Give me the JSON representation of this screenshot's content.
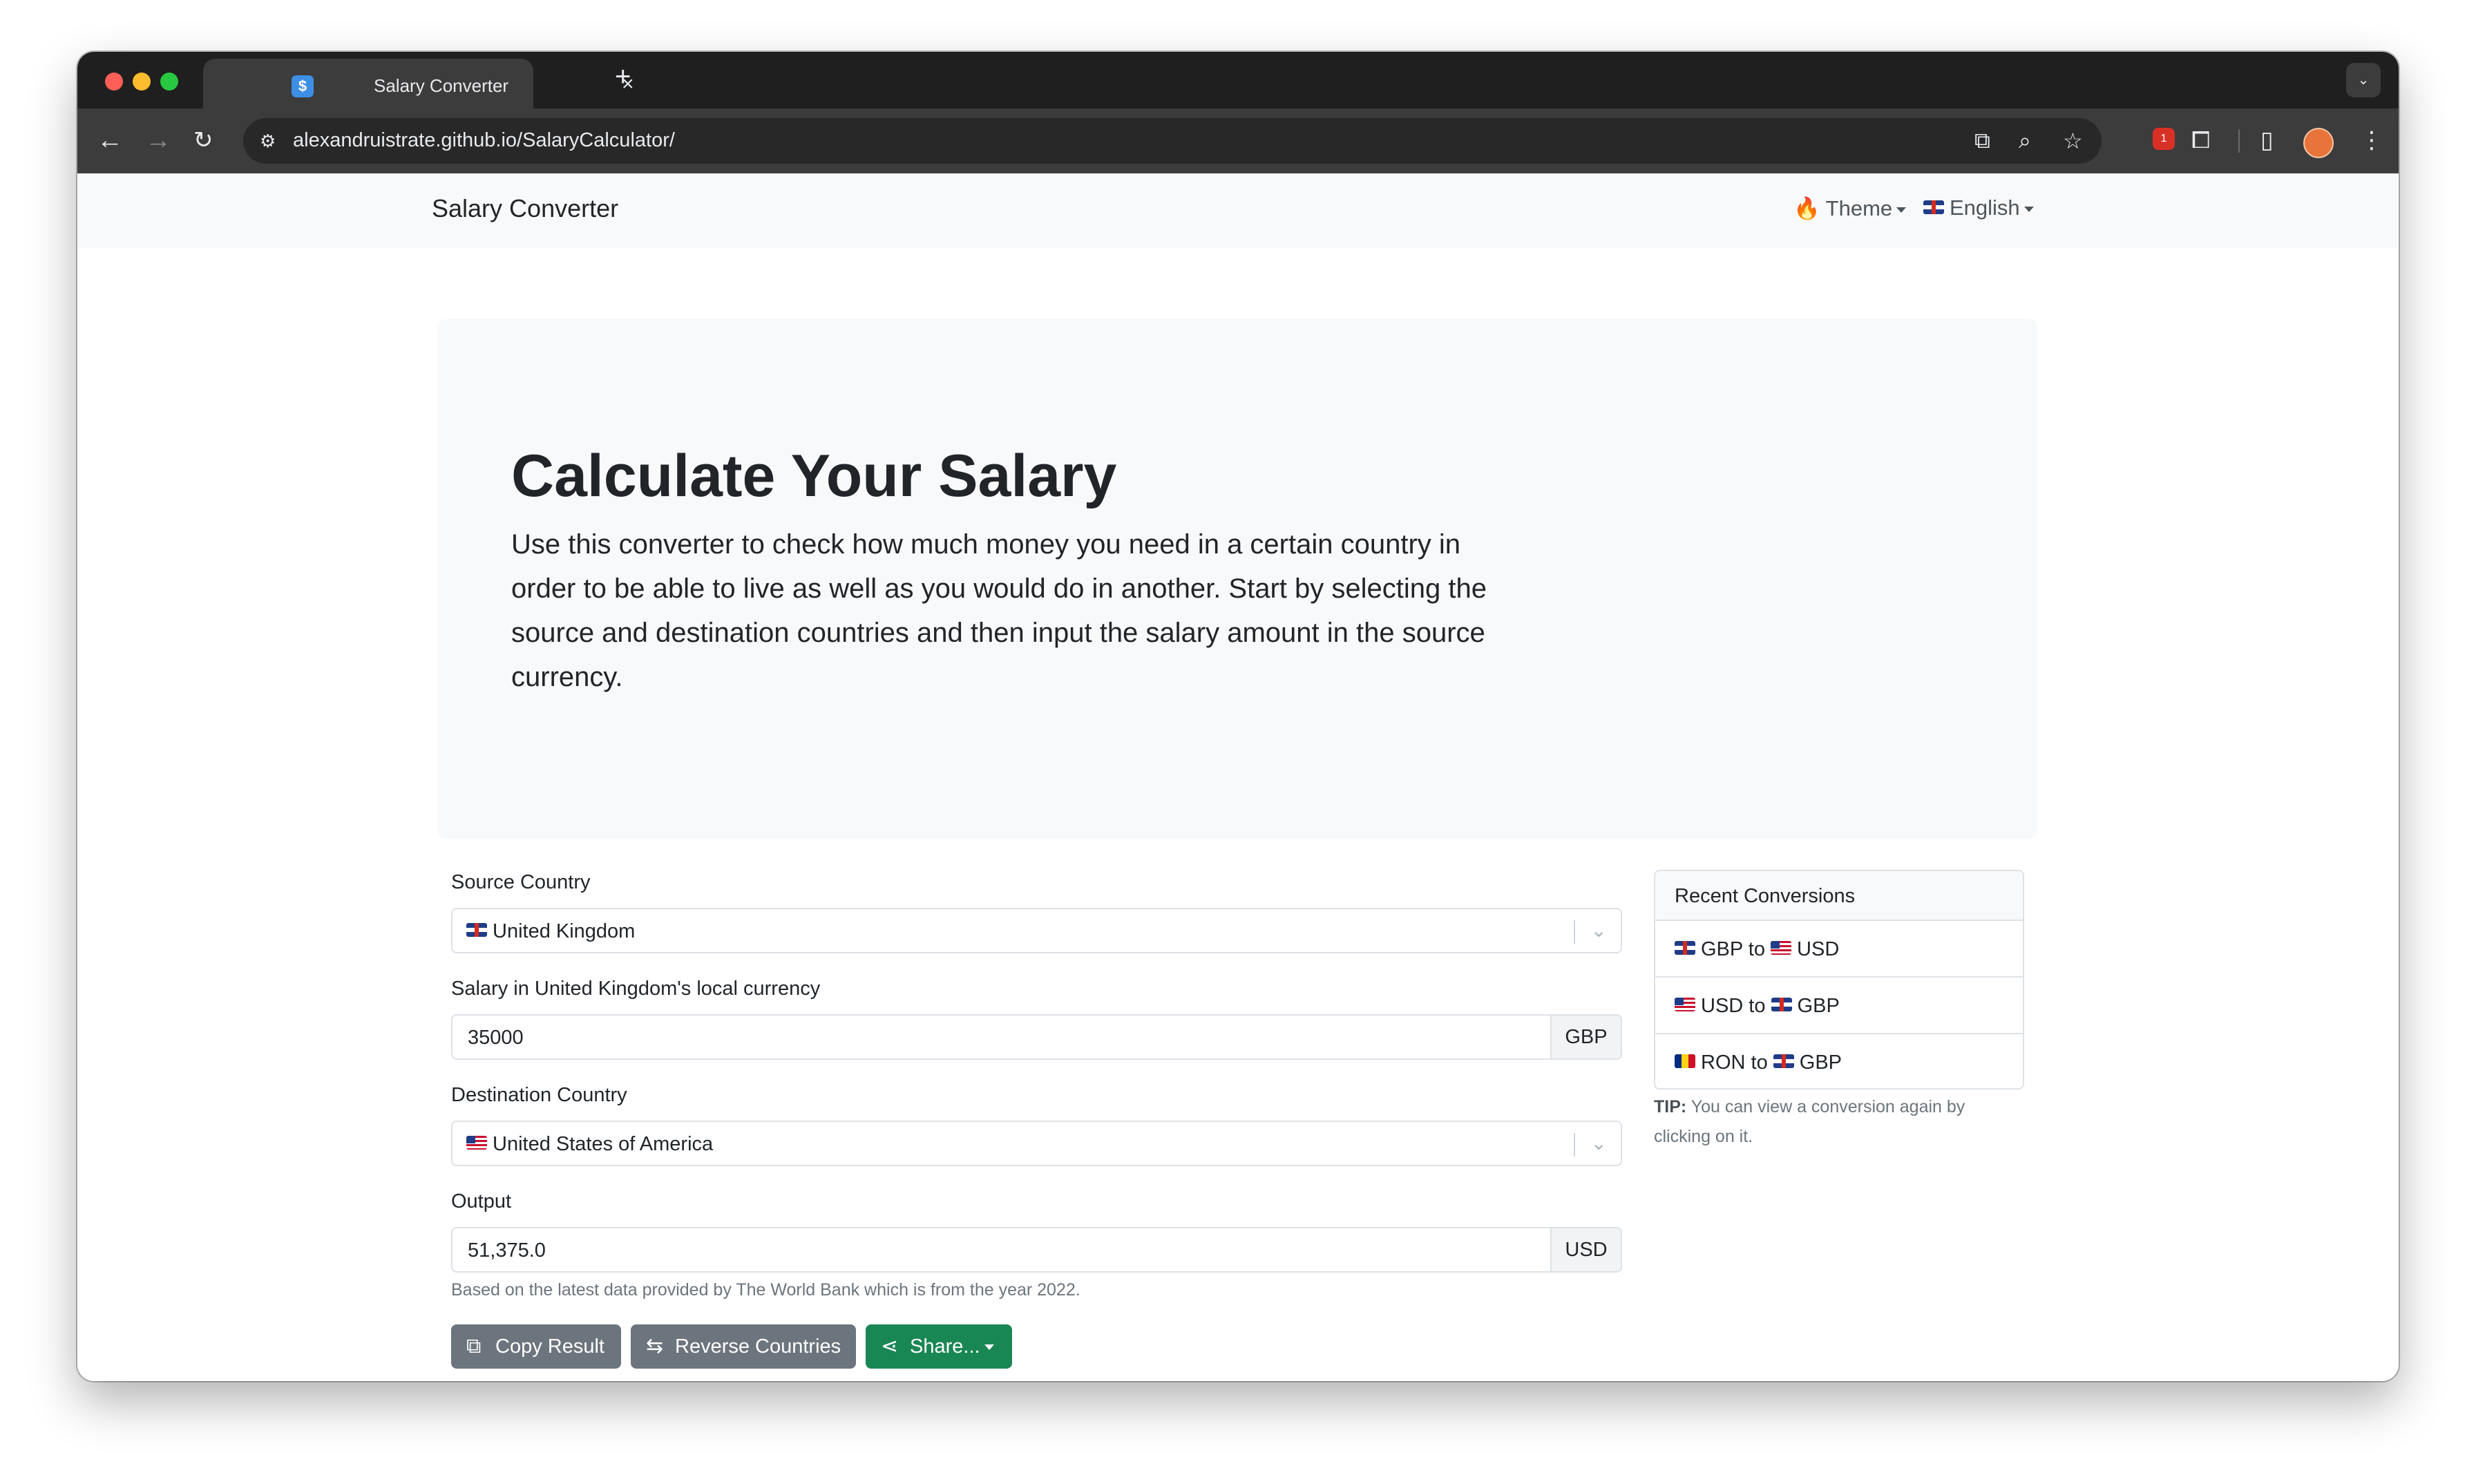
{
  "browser": {
    "tab_title": "Salary Converter",
    "url": "alexandruistrate.github.io/SalaryCalculator/",
    "tab_close_glyph": "×",
    "new_tab_glyph": "+",
    "ext_badge": "1"
  },
  "navbar": {
    "brand": "Salary Converter",
    "theme_label": "Theme",
    "theme_icon": "🔥",
    "language_label": "English"
  },
  "hero": {
    "title": "Calculate Your Salary",
    "lead": "Use this converter to check how much money you need in a certain country in order to be able to live as well as you would do in another. Start by selecting the source and destination countries and then input the salary amount in the source currency."
  },
  "form": {
    "source_label": "Source Country",
    "source_value": "United Kingdom",
    "salary_label": "Salary in United Kingdom's local currency",
    "salary_value": "35000",
    "salary_currency": "GBP",
    "destination_label": "Destination Country",
    "destination_value": "United States of America",
    "output_label": "Output",
    "output_value": "51,375.0",
    "output_currency": "USD",
    "hint": "Based on the latest data provided by The World Bank which is from the year 2022."
  },
  "buttons": {
    "copy": "Copy Result",
    "reverse": "Reverse Countries",
    "share": "Share..."
  },
  "recent": {
    "title": "Recent Conversions",
    "items": [
      {
        "from": "GBP",
        "to": "USD",
        "sep": "to",
        "from_flag": "uk",
        "to_flag": "us"
      },
      {
        "from": "USD",
        "to": "GBP",
        "sep": "to",
        "from_flag": "us",
        "to_flag": "uk"
      },
      {
        "from": "RON",
        "to": "GBP",
        "sep": "to",
        "from_flag": "ro",
        "to_flag": "uk"
      }
    ],
    "tip_label": "TIP:",
    "tip_text": "You can view a conversion again by clicking on it."
  },
  "colors": {
    "primary_gray": "#6c757d",
    "success_green": "#198754",
    "hero_bg": "#f8f9fa"
  }
}
